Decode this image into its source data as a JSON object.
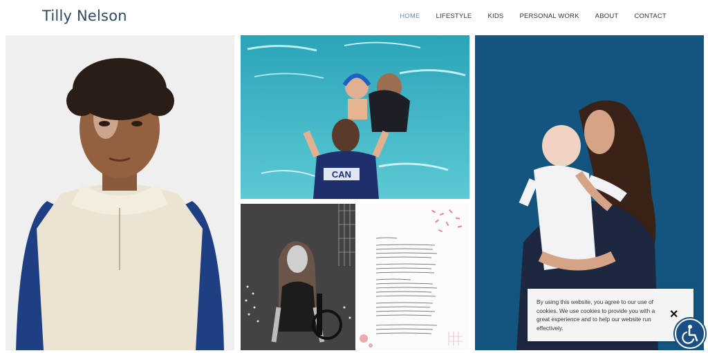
{
  "site": {
    "title": "Tilly Nelson"
  },
  "nav": {
    "items": [
      {
        "label": "HOME",
        "active": true
      },
      {
        "label": "LIFESTYLE",
        "active": false
      },
      {
        "label": "KIDS",
        "active": false
      },
      {
        "label": "PERSONAL WORK",
        "active": false
      },
      {
        "label": "ABOUT",
        "active": false
      },
      {
        "label": "CONTACT",
        "active": false
      }
    ]
  },
  "gallery": {
    "swim_vest_text": "CAN"
  },
  "cookie": {
    "text": "By using this website, you agree to our use of cookies. We use cookies to provide you with a great experience and to help our website run effectively.",
    "close_icon": "close-icon"
  },
  "accessibility": {
    "icon": "wheelchair-icon"
  },
  "colors": {
    "brand": "#2d4a63",
    "nav_active": "#5b8ec7",
    "a11y_button": "#1a4f86"
  }
}
